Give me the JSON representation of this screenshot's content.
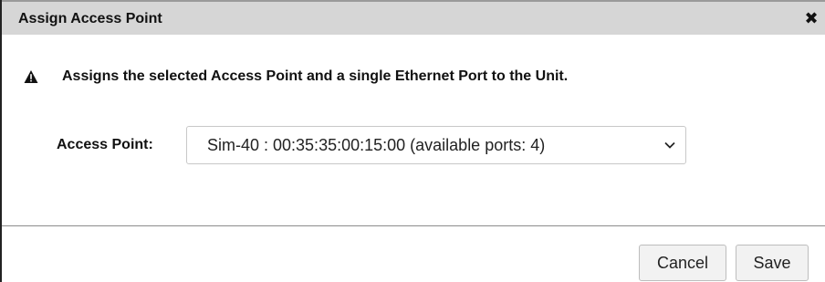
{
  "dialog": {
    "title": "Assign Access Point",
    "close_icon": "close-icon",
    "message": "Assigns the selected Access Point and a single Ethernet Port to the Unit.",
    "warning_icon": "warning-icon",
    "field": {
      "label": "Access Point:",
      "value": "Sim-40 : 00:35:35:00:15:00 (available ports: 4)",
      "icon": "chevron-down-icon"
    },
    "buttons": {
      "cancel": "Cancel",
      "save": "Save"
    }
  }
}
